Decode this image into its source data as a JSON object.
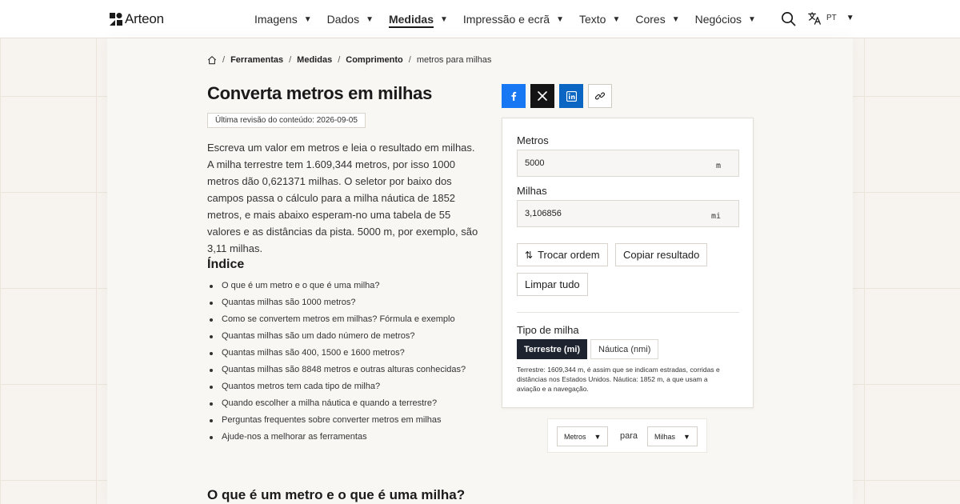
{
  "header": {
    "brand": "Arteon",
    "nav": [
      {
        "label": "Imagens",
        "active": false
      },
      {
        "label": "Dados",
        "active": false
      },
      {
        "label": "Medidas",
        "active": true
      },
      {
        "label": "Impressão e ecrã",
        "active": false
      },
      {
        "label": "Texto",
        "active": false
      },
      {
        "label": "Cores",
        "active": false
      },
      {
        "label": "Negócios",
        "active": false
      }
    ],
    "caret": "▼",
    "lang": "PT"
  },
  "breadcrumb": {
    "sep": "/",
    "items": [
      "Ferramentas",
      "Medidas",
      "Comprimento"
    ],
    "current": "metros para milhas"
  },
  "page": {
    "title": "Converta metros em milhas",
    "revision": "Última revisão do conteúdo: 2026-09-05",
    "intro": "Escreva um valor em metros e leia o resultado em milhas. A milha terrestre tem 1.609,344 metros, por isso 1000 metros dão 0,621371 milhas. O seletor por baixo dos campos passa o cálculo para a milha náutica de 1852 metros, e mais abaixo esperam-no uma tabela de 55 valores e as distâncias da pista. 5000 m, por exemplo, são 3,11 milhas.",
    "toc_title": "Índice",
    "toc": [
      "O que é um metro e o que é uma milha?",
      "Quantas milhas são 1000 metros?",
      "Como se convertem metros em milhas? Fórmula e exemplo",
      "Quantas milhas são um dado número de metros?",
      "Quantas milhas são 400, 1500 e 1600 metros?",
      "Quantas milhas são 8848 metros e outras alturas conhecidas?",
      "Quantos metros tem cada tipo de milha?",
      "Quando escolher a milha náutica e quando a terrestre?",
      "Perguntas frequentes sobre converter metros em milhas",
      "Ajude-nos a melhorar as ferramentas"
    ],
    "section_title": "O que é um metro e o que é uma milha?"
  },
  "converter": {
    "from_label": "Metros",
    "from_value": "5000",
    "from_unit": "m",
    "to_label": "Milhas",
    "to_value": "3,106856",
    "to_unit": "mi",
    "swap_icon": "⇅",
    "swap_label": "Trocar ordem",
    "copy_label": "Copiar resultado",
    "clear_label": "Limpar tudo",
    "type_label": "Tipo de milha",
    "type_options": [
      "Terrestre (mi)",
      "Náutica (nmi)"
    ],
    "type_selected": "Terrestre (mi)",
    "hint": "Terrestre: 1609,344 m, é assim que se indicam estradas, corridas e distâncias nos Estados Unidos. Náutica: 1852 m, a que usam a aviação e a navegação."
  },
  "direction": {
    "from": "Metros",
    "to": "Milhas",
    "connector": "para",
    "caret": "▼"
  },
  "colors": {
    "facebook": "#1877f2",
    "x": "#141414",
    "linkedin": "#0a66c2",
    "active_segment": "#1d2430"
  }
}
